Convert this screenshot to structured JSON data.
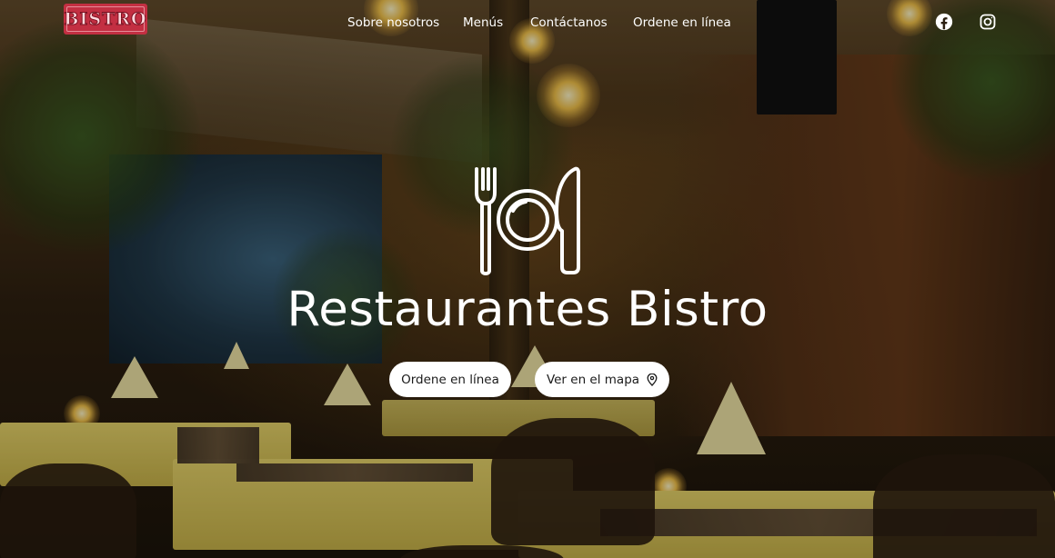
{
  "brand": {
    "logo_text": "BISTRO"
  },
  "nav": {
    "links": [
      {
        "label": "Sobre nosotros"
      },
      {
        "label": "Menús"
      },
      {
        "label": "Contáctanos"
      },
      {
        "label": "Ordene en línea"
      }
    ],
    "social": [
      {
        "icon": "facebook-icon"
      },
      {
        "icon": "instagram-icon"
      }
    ]
  },
  "hero": {
    "emblem_icon": "fork-plate-knife-icon",
    "title": "Restaurantes Bistro",
    "buttons": {
      "order_label": "Ordene en línea",
      "map_label": "Ver en el mapa",
      "map_icon": "map-pin-icon"
    }
  },
  "colors": {
    "logo_bg": "#c32f42",
    "button_bg": "#ffffff",
    "text": "#ffffff"
  }
}
